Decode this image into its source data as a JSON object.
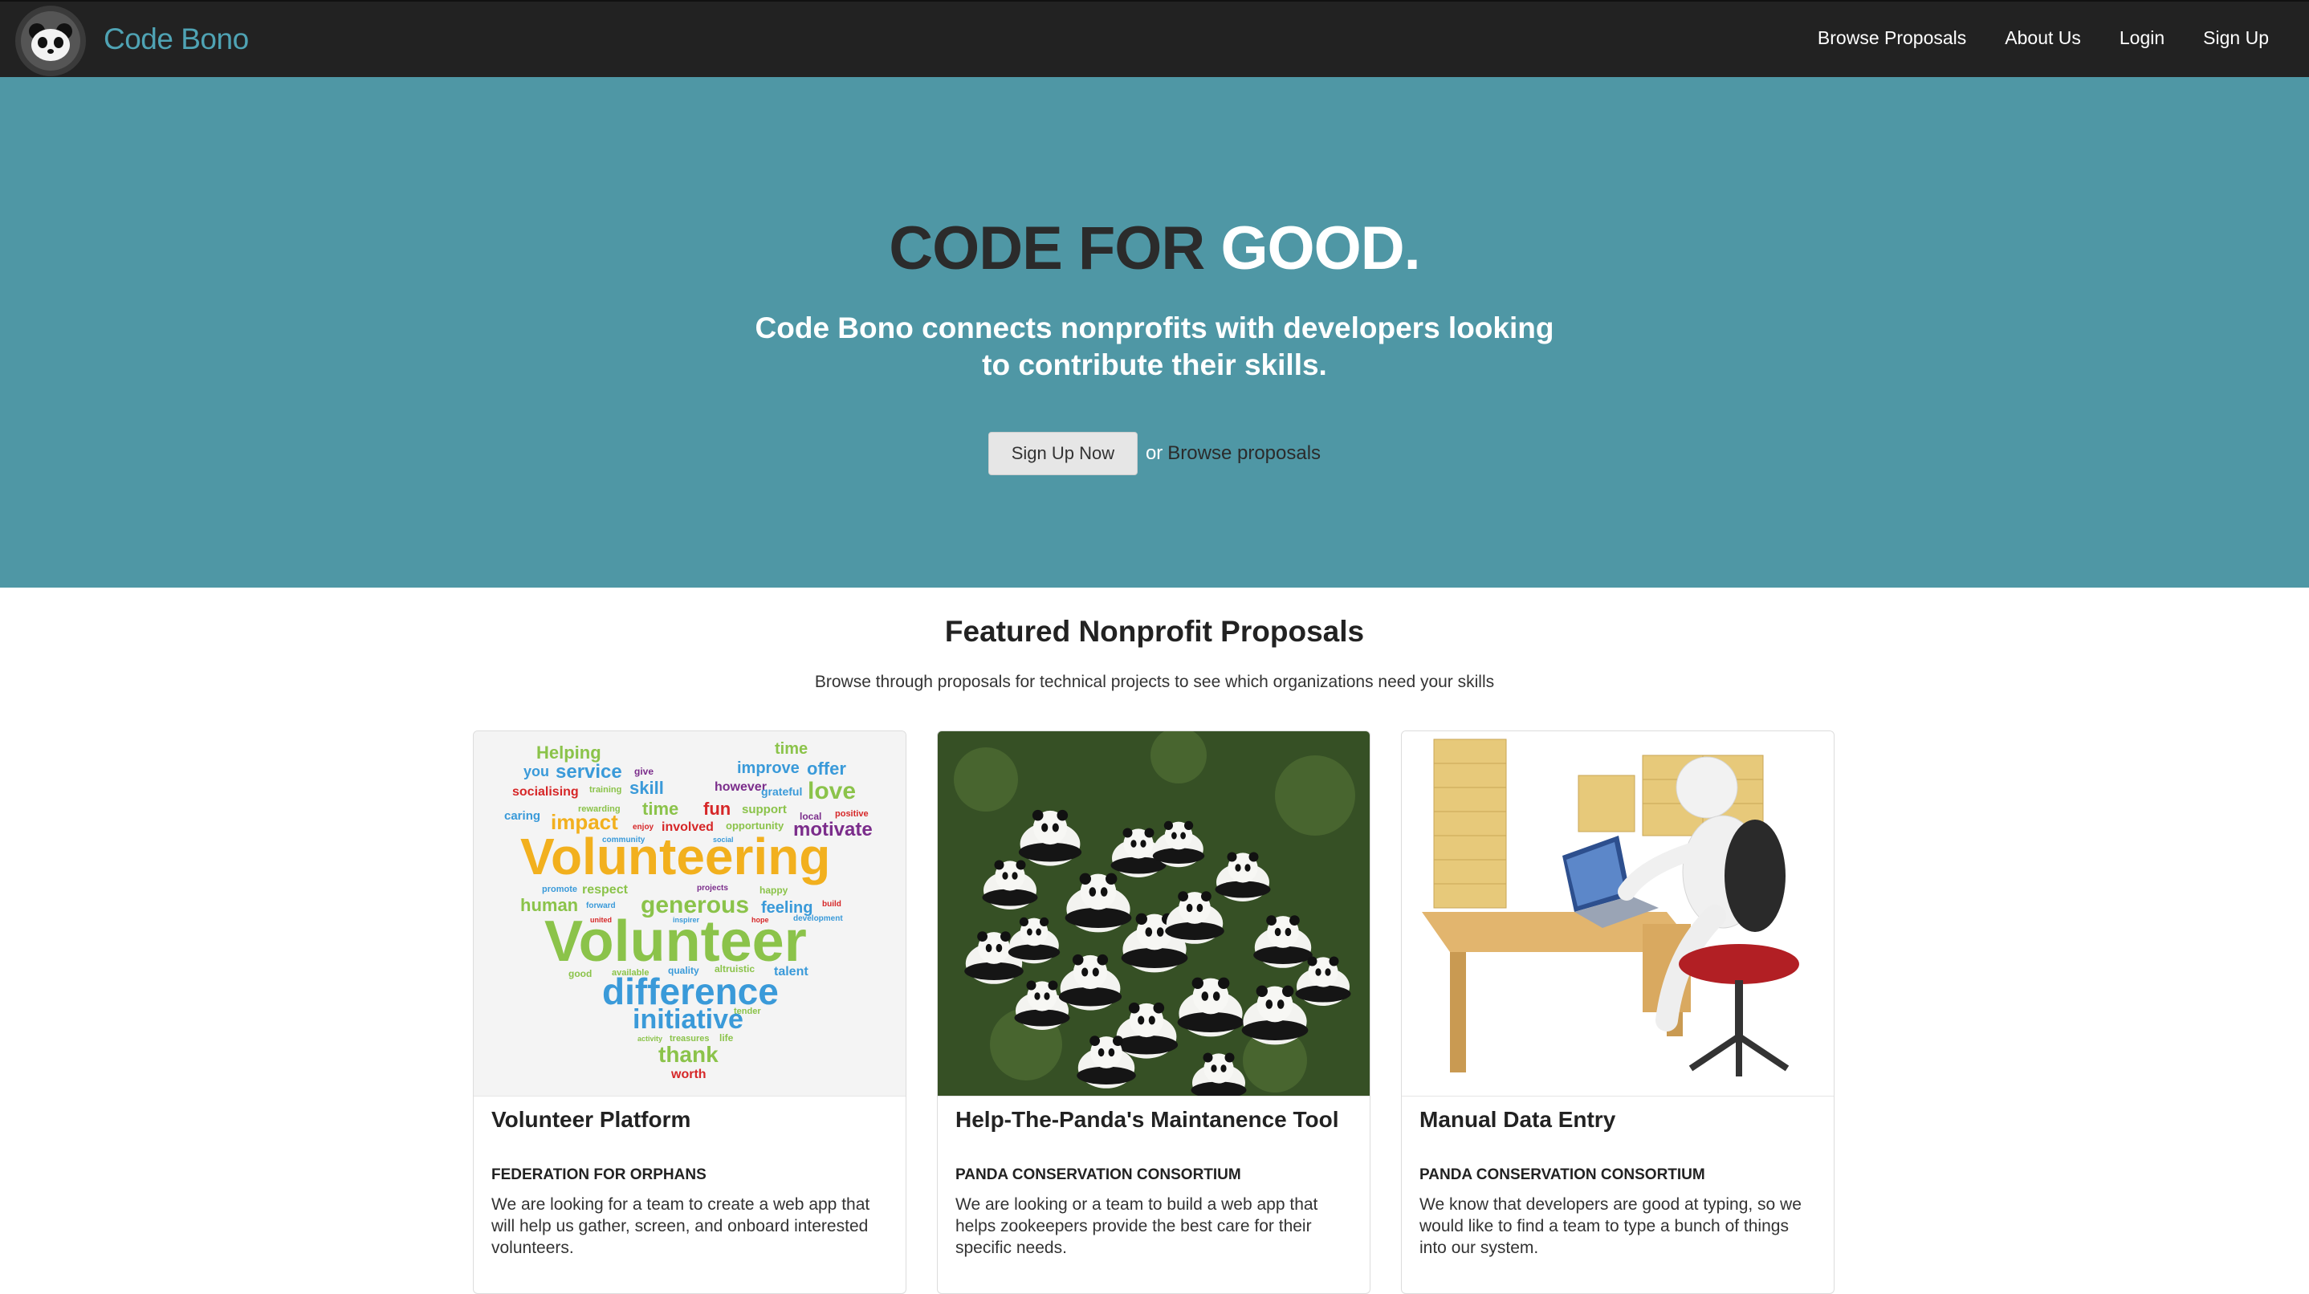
{
  "nav": {
    "brand": "Code Bono",
    "links": [
      "Browse Proposals",
      "About Us",
      "Login",
      "Sign Up"
    ]
  },
  "hero": {
    "title_dark": "CODE FOR",
    "title_light": "GOOD.",
    "subtitle": "Code Bono connects nonprofits with developers looking to contribute their skills.",
    "cta_button": "Sign Up Now",
    "cta_or": "or",
    "cta_link": "Browse proposals"
  },
  "featured": {
    "title": "Featured Nonprofit Proposals",
    "subtitle": "Browse through proposals for technical projects to see which organizations need your skills",
    "cards": [
      {
        "title": "Volunteer Platform",
        "org": "FEDERATION FOR ORPHANS",
        "description": "We are looking for a team to create a web app that will help us gather, screen, and onboard interested volunteers."
      },
      {
        "title": "Help-The-Panda's Maintanence Tool",
        "org": "PANDA CONSERVATION CONSORTIUM",
        "description": "We are looking or a team to build a web app that helps zookeepers provide the best care for their specific needs."
      },
      {
        "title": "Manual Data Entry",
        "org": "PANDA CONSERVATION CONSORTIUM",
        "description": "We know that developers are good at typing, so we would like to find a team to type a bunch of things into our system."
      }
    ]
  },
  "wordcloud": {
    "words": [
      "Helping",
      "time",
      "you",
      "service",
      "give",
      "improve",
      "offer",
      "socialising",
      "training",
      "skill",
      "however",
      "grateful",
      "love",
      "caring",
      "rewarding",
      "time",
      "fun",
      "support",
      "local",
      "positive",
      "impact",
      "enjoy",
      "involved",
      "opportunity",
      "motivate",
      "community",
      "social",
      "Volunteering",
      "promote",
      "respect",
      "projects",
      "happy",
      "human",
      "forward",
      "generous",
      "feeling",
      "build",
      "united",
      "inspirer",
      "hope",
      "development",
      "Volunteer",
      "good",
      "available",
      "quality",
      "altruistic",
      "talent",
      "difference",
      "tender",
      "initiative",
      "activity",
      "treasures",
      "life",
      "thank",
      "worth"
    ]
  },
  "colors": {
    "nav_bg": "#222222",
    "brand": "#4fa3b4",
    "hero_bg": "#4f97a5",
    "hero_title": "#2b2b2b",
    "white": "#ffffff"
  },
  "icons": {
    "logo": "panda-logo-icon"
  }
}
